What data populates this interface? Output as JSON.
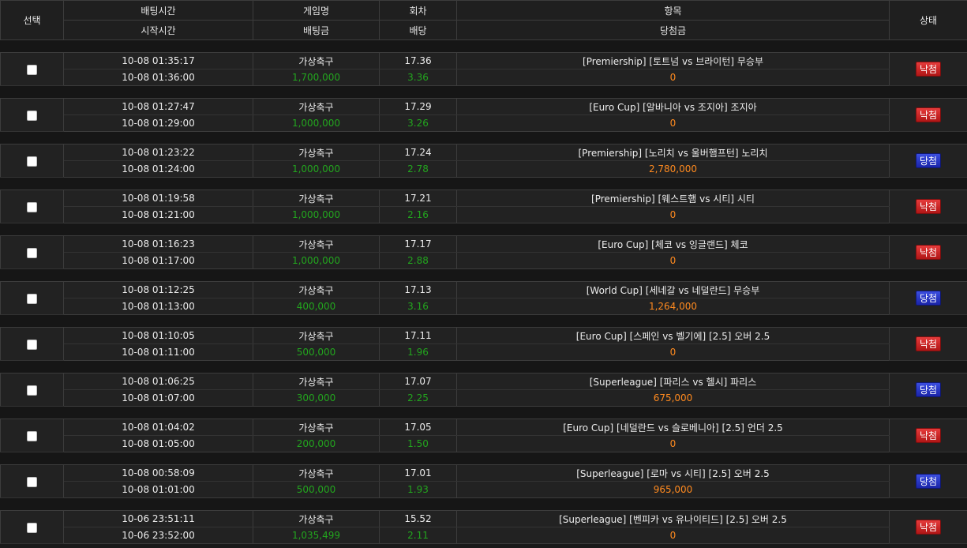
{
  "headers": {
    "select": "선택",
    "bet_time": "배팅시간",
    "start_time": "시작시간",
    "game": "게임명",
    "bet_amount": "배팅금",
    "round": "회차",
    "odds": "배당",
    "item": "항목",
    "win_amount": "당첨금",
    "status": "상태"
  },
  "status_colors": {
    "lose": "#c62020",
    "win": "#2a36c8",
    "amount_green": "#22a51e",
    "win_orange": "#ff8a1f"
  },
  "rows": [
    {
      "bet_time": "10-08 01:35:17",
      "start_time": "10-08 01:36:00",
      "game": "가상축구",
      "amount": "1,700,000",
      "round": "17.36",
      "odds": "3.36",
      "item": "[Premiership] [토트넘 vs 브라이턴] 무승부",
      "payout": "0",
      "status": "낙첨",
      "result": "lose"
    },
    {
      "bet_time": "10-08 01:27:47",
      "start_time": "10-08 01:29:00",
      "game": "가상축구",
      "amount": "1,000,000",
      "round": "17.29",
      "odds": "3.26",
      "item": "[Euro Cup] [알바니아 vs 조지아] 조지아",
      "payout": "0",
      "status": "낙첨",
      "result": "lose"
    },
    {
      "bet_time": "10-08 01:23:22",
      "start_time": "10-08 01:24:00",
      "game": "가상축구",
      "amount": "1,000,000",
      "round": "17.24",
      "odds": "2.78",
      "item": "[Premiership] [노리치 vs 울버햄프턴] 노리치",
      "payout": "2,780,000",
      "status": "당첨",
      "result": "win"
    },
    {
      "bet_time": "10-08 01:19:58",
      "start_time": "10-08 01:21:00",
      "game": "가상축구",
      "amount": "1,000,000",
      "round": "17.21",
      "odds": "2.16",
      "item": "[Premiership] [웨스트햄 vs 시티] 시티",
      "payout": "0",
      "status": "낙첨",
      "result": "lose"
    },
    {
      "bet_time": "10-08 01:16:23",
      "start_time": "10-08 01:17:00",
      "game": "가상축구",
      "amount": "1,000,000",
      "round": "17.17",
      "odds": "2.88",
      "item": "[Euro Cup] [체코 vs 잉글랜드] 체코",
      "payout": "0",
      "status": "낙첨",
      "result": "lose"
    },
    {
      "bet_time": "10-08 01:12:25",
      "start_time": "10-08 01:13:00",
      "game": "가상축구",
      "amount": "400,000",
      "round": "17.13",
      "odds": "3.16",
      "item": "[World Cup] [세네갈 vs 네덜란드] 무승부",
      "payout": "1,264,000",
      "status": "당첨",
      "result": "win"
    },
    {
      "bet_time": "10-08 01:10:05",
      "start_time": "10-08 01:11:00",
      "game": "가상축구",
      "amount": "500,000",
      "round": "17.11",
      "odds": "1.96",
      "item": "[Euro Cup] [스페인 vs 벨기에] [2.5] 오버 2.5",
      "payout": "0",
      "status": "낙첨",
      "result": "lose"
    },
    {
      "bet_time": "10-08 01:06:25",
      "start_time": "10-08 01:07:00",
      "game": "가상축구",
      "amount": "300,000",
      "round": "17.07",
      "odds": "2.25",
      "item": "[Superleague] [파리스 vs 헬시] 파리스",
      "payout": "675,000",
      "status": "당첨",
      "result": "win"
    },
    {
      "bet_time": "10-08 01:04:02",
      "start_time": "10-08 01:05:00",
      "game": "가상축구",
      "amount": "200,000",
      "round": "17.05",
      "odds": "1.50",
      "item": "[Euro Cup] [네덜란드 vs 슬로베니아] [2.5] 언더 2.5",
      "payout": "0",
      "status": "낙첨",
      "result": "lose"
    },
    {
      "bet_time": "10-08 00:58:09",
      "start_time": "10-08 01:01:00",
      "game": "가상축구",
      "amount": "500,000",
      "round": "17.01",
      "odds": "1.93",
      "item": "[Superleague] [로마 vs 시티] [2.5] 오버 2.5",
      "payout": "965,000",
      "status": "당첨",
      "result": "win"
    },
    {
      "bet_time": "10-06 23:51:11",
      "start_time": "10-06 23:52:00",
      "game": "가상축구",
      "amount": "1,035,499",
      "round": "15.52",
      "odds": "2.11",
      "item": "[Superleague] [벤피카 vs 유나이티드] [2.5] 오버 2.5",
      "payout": "0",
      "status": "낙첨",
      "result": "lose"
    }
  ]
}
